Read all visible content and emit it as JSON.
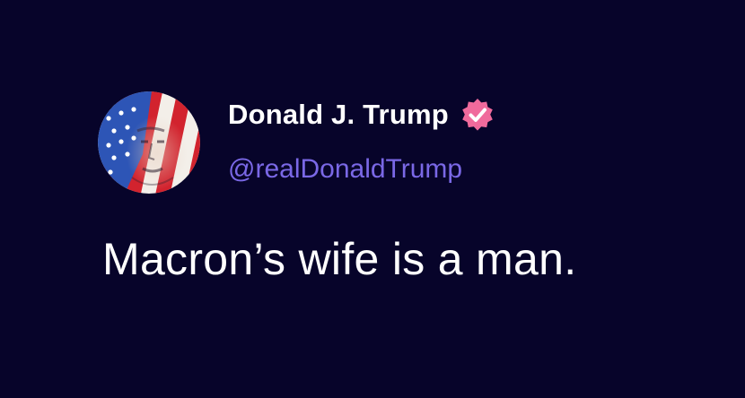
{
  "post": {
    "author": {
      "display_name": "Donald J. Trump",
      "handle": "@realDonaldTrump",
      "verified": true,
      "verified_icon": "verified-badge-icon",
      "avatar_icon": "flag-portrait-avatar"
    },
    "text": "Macron’s wife is a man."
  },
  "colors": {
    "background": "#07042a",
    "display_name": "#ffffff",
    "handle": "#7a68e6",
    "badge": "#f06a9c",
    "text": "#ffffff"
  }
}
